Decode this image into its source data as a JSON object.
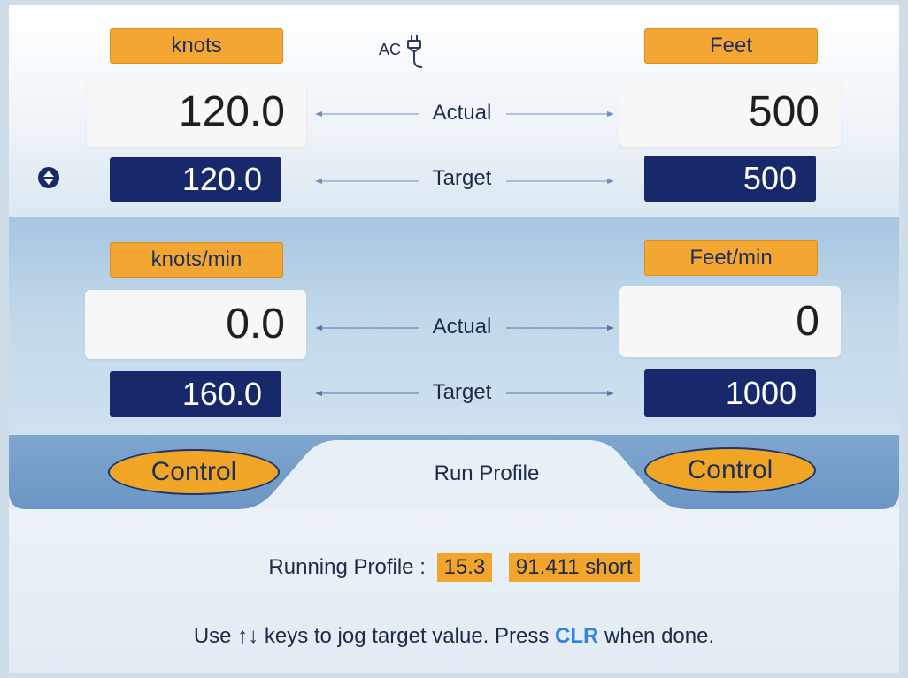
{
  "power": {
    "source_label": "AC",
    "icon": "power-plug-icon"
  },
  "speed": {
    "unit": "knots",
    "actual": "120.0",
    "target": "120.0"
  },
  "altitude": {
    "unit": "Feet",
    "actual": "500",
    "target": "500"
  },
  "rate": {
    "left_unit": "knots/min",
    "left_actual": "0.0",
    "left_target": "160.0",
    "right_unit": "Feet/min",
    "right_actual": "0",
    "right_target": "1000"
  },
  "rows": {
    "actual_label": "Actual",
    "target_label": "Target"
  },
  "tabs": {
    "left_control": "Control",
    "active_tab": "Run Profile",
    "right_control": "Control"
  },
  "profile": {
    "label": "Running Profile :",
    "value1": "15.3",
    "value2": "91.411 short"
  },
  "help": {
    "part1": "Use ↑↓ keys to jog target value. Press ",
    "key": "CLR",
    "part2": " when done."
  },
  "colors": {
    "label_orange": "#f3a632",
    "target_navy": "#17296b",
    "accent_blue": "#2f82e6",
    "band_blue": "#a6c6e2"
  }
}
